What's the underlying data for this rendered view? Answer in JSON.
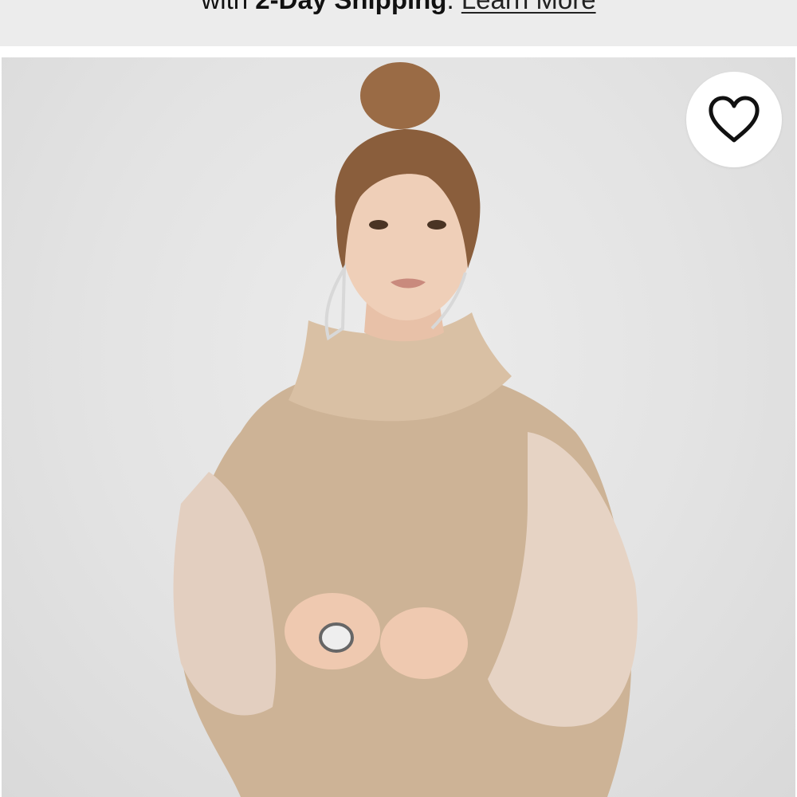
{
  "banner": {
    "prefix": "with ",
    "bold": "2-Day Shipping",
    "suffix": ". ",
    "link": "Learn More"
  },
  "product": {
    "favorite_icon": "heart-outline-icon"
  },
  "colors": {
    "banner_bg": "#ececec",
    "sweater": "#cdb396",
    "sleeve": "#e6d3c4",
    "hair": "#8a5e3c"
  }
}
